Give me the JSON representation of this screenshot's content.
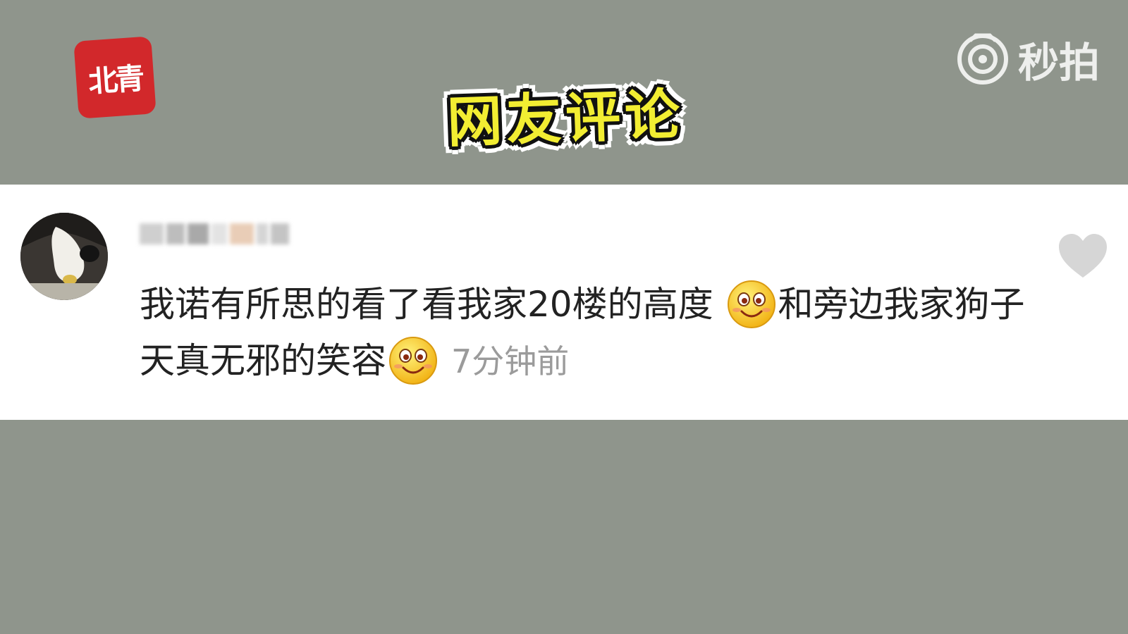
{
  "logo": {
    "text": "北青",
    "color": "#d2282b"
  },
  "watermark": {
    "icon": "eye-camera-icon",
    "text": "秒拍"
  },
  "title": {
    "text": "网友评论",
    "color": "#f2ed32"
  },
  "comment": {
    "avatar_icon": "dog-avatar",
    "text_part1": "我诺有所思的看了看我家20楼的高度 ",
    "text_part2": "和旁边我家狗子天真无邪的笑容",
    "emoji_icon": "smiling-face-icon",
    "timestamp": "7分钟前",
    "like_icon": "heart-icon"
  },
  "colors": {
    "background": "#8f958c",
    "card": "#ffffff",
    "text": "#222222",
    "timestamp": "#9b9b9b",
    "heart": "#d6d6d6"
  }
}
